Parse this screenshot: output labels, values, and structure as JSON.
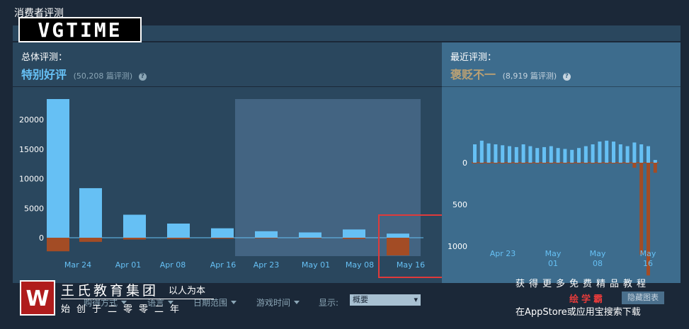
{
  "header": {
    "title": "消费者评测"
  },
  "watermark": {
    "logo_text": "VGTIME"
  },
  "overall": {
    "title": "总体评测：",
    "rating": "特别好评",
    "count": "(50,208 篇评测)",
    "rating_color": "#66c0f4"
  },
  "recent": {
    "title": "最近评测：",
    "rating": "褒贬不一",
    "count": "(8,919 篇评测)",
    "rating_color": "#b9a074"
  },
  "help_icon": "question-icon",
  "controls": {
    "purchase_type": "购得方式",
    "language": "语言",
    "date_range": "日期范围",
    "playtime": "游戏时间",
    "display_label": "显示:",
    "display_value": "概要",
    "hide_chart": "隐藏图表"
  },
  "ad": {
    "logo_text": "W",
    "name": "王氏教育集团",
    "tagline": "以人为本",
    "sub": "始创于二零零二年"
  },
  "promo": {
    "line1": "获得更多免费精品教程",
    "brand": "绘学霸",
    "line3": "在AppStore或应用宝搜索下载"
  },
  "chart_data": [
    {
      "type": "bar",
      "title": "总体评测",
      "ylim": [
        -2400,
        24000
      ],
      "yticks": [
        "20000",
        "15000",
        "10000",
        "5000",
        "0"
      ],
      "categories": [
        "Mar 24",
        "Apr 01",
        "Apr 08",
        "Apr 16",
        "Apr 23",
        "May 01",
        "May 08",
        "May 16"
      ],
      "series": [
        {
          "name": "positive",
          "color": "#66c0f4",
          "values": [
            23500,
            8400,
            3900,
            2400,
            1600,
            1100,
            900,
            1400,
            700
          ]
        },
        {
          "name": "negative",
          "color": "#a34c25",
          "values": [
            -2300,
            -700,
            -300,
            -200,
            -150,
            -100,
            -100,
            -200,
            -3000
          ]
        }
      ],
      "highlight_category": "May 16"
    },
    {
      "type": "bar",
      "title": "最近评测",
      "yticks": [
        "0",
        "500",
        "1000"
      ],
      "categories": [
        "Apr 23",
        "May 01",
        "May 08",
        "May 16"
      ],
      "series": [
        {
          "name": "positive",
          "color": "#66c0f4",
          "values": [
            200,
            240,
            210,
            200,
            190,
            180,
            170,
            200,
            180,
            160,
            170,
            180,
            160,
            150,
            140,
            160,
            180,
            200,
            230,
            240,
            230,
            200,
            180,
            220,
            200,
            180,
            30
          ]
        },
        {
          "name": "negative",
          "color": "#a34c25",
          "values": [
            -10,
            -10,
            -10,
            -10,
            -10,
            -10,
            -10,
            -10,
            -10,
            -10,
            -10,
            -10,
            -10,
            -10,
            -10,
            -10,
            -10,
            -10,
            -10,
            -10,
            -10,
            -10,
            -10,
            -60,
            -1100,
            -1350,
            -120
          ]
        }
      ]
    }
  ]
}
